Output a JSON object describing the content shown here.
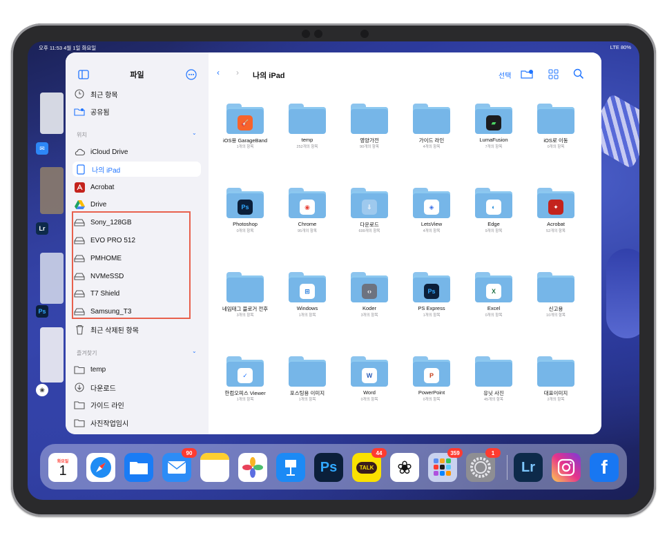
{
  "status": {
    "time_date": "오후 11:53  4월 1일 화요일",
    "right": "LTE  80%"
  },
  "sidebar": {
    "title": "파일",
    "items": [
      {
        "label": "최근 항목",
        "icon": "clock-icon"
      },
      {
        "label": "공유됨",
        "icon": "shared-folder-icon"
      }
    ],
    "locations_label": "위치",
    "locations": [
      {
        "label": "iCloud Drive",
        "icon": "cloud-icon"
      },
      {
        "label": "나의 iPad",
        "icon": "ipad-icon",
        "selected": true
      },
      {
        "label": "Acrobat",
        "icon": "acrobat-icon"
      },
      {
        "label": "Drive",
        "icon": "google-drive-icon"
      },
      {
        "label": "Sony_128GB",
        "icon": "drive-icon"
      },
      {
        "label": "EVO PRO 512",
        "icon": "drive-icon"
      },
      {
        "label": "PMHOME",
        "icon": "drive-icon"
      },
      {
        "label": "NVMeSSD",
        "icon": "drive-icon"
      },
      {
        "label": "T7 Shield",
        "icon": "drive-icon"
      },
      {
        "label": "Samsung_T3",
        "icon": "drive-icon"
      },
      {
        "label": "최근 삭제된 항목",
        "icon": "trash-icon"
      }
    ],
    "favorites_label": "즐겨찾기",
    "favorites": [
      {
        "label": "temp",
        "icon": "folder-icon"
      },
      {
        "label": "다운로드",
        "icon": "download-icon"
      },
      {
        "label": "가이드 라인",
        "icon": "folder-icon"
      },
      {
        "label": "사진작업임시",
        "icon": "folder-icon"
      }
    ]
  },
  "main": {
    "title": "나의 iPad",
    "select_label": "선택",
    "folders": [
      {
        "name": "iOS용 GarageBand",
        "count": "1개의 항목",
        "badge": "garageband",
        "color": "#f7632b"
      },
      {
        "name": "temp",
        "count": "252개의 항목"
      },
      {
        "name": "영양가전",
        "count": "90개의 항목"
      },
      {
        "name": "가이드 라인",
        "count": "4개의 항목"
      },
      {
        "name": "LumaFusion",
        "count": "7개의 항목",
        "badge": "lumafusion",
        "color": "#1c1c1e"
      },
      {
        "name": "iOS로 이동",
        "count": "0개의 항목"
      },
      {
        "name": "Photoshop",
        "count": "0개의 항목",
        "badge": "Ps",
        "color": "#0b1f3a"
      },
      {
        "name": "Chrome",
        "count": "95개의 항목",
        "badge": "chrome",
        "color": "#ffffff"
      },
      {
        "name": "다운로드",
        "count": "699개의 항목",
        "badge": "download",
        "color": "#9ec9ee"
      },
      {
        "name": "LetsView",
        "count": "4개의 항목",
        "badge": "letsview",
        "color": "#ffffff"
      },
      {
        "name": "Edge",
        "count": "9개의 항목",
        "badge": "edge",
        "color": "#ffffff"
      },
      {
        "name": "Acrobat",
        "count": "52개의 항목",
        "badge": "acrobat",
        "color": "#c4231d"
      },
      {
        "name": "네임태그 블로거 전후",
        "count": "3개의 항목"
      },
      {
        "name": "Windows",
        "count": "1개의 항목",
        "badge": "windows",
        "color": "#ffffff"
      },
      {
        "name": "Koder",
        "count": "3개의 항목",
        "badge": "koder",
        "color": "#6d7380"
      },
      {
        "name": "PS Express",
        "count": "1개의 항목",
        "badge": "Ps",
        "color": "#0b1f3a"
      },
      {
        "name": "Excel",
        "count": "0개의 항목",
        "badge": "excel",
        "color": "#ffffff"
      },
      {
        "name": "신고용",
        "count": "10개의 항목"
      },
      {
        "name": "한컴오피스 Viewer",
        "count": "1개의 항목",
        "badge": "hancom",
        "color": "#ffffff"
      },
      {
        "name": "포스팅용 이미지",
        "count": "1개의 항목"
      },
      {
        "name": "Word",
        "count": "0개의 항목",
        "badge": "word",
        "color": "#ffffff"
      },
      {
        "name": "PowerPoint",
        "count": "0개의 항목",
        "badge": "powerpoint",
        "color": "#ffffff"
      },
      {
        "name": "유닛 사진",
        "count": "45개의 항목"
      },
      {
        "name": "대표이미지",
        "count": "2개의 항목"
      }
    ]
  },
  "dock": {
    "calendar_day": "화요일",
    "calendar_date": "1",
    "apps": [
      {
        "name": "calendar",
        "badge": ""
      },
      {
        "name": "safari",
        "badge": ""
      },
      {
        "name": "files",
        "badge": ""
      },
      {
        "name": "mail",
        "badge": "90"
      },
      {
        "name": "notes",
        "badge": ""
      },
      {
        "name": "photos",
        "badge": ""
      },
      {
        "name": "keynote",
        "badge": ""
      },
      {
        "name": "photoshop",
        "label": "Ps",
        "badge": ""
      },
      {
        "name": "kakaotalk",
        "label": "TALK",
        "badge": "44"
      },
      {
        "name": "chatgpt",
        "badge": ""
      },
      {
        "name": "app-folder",
        "badge": "359"
      },
      {
        "name": "settings",
        "badge": "1"
      },
      {
        "name": "lightroom",
        "label": "Lr",
        "badge": ""
      },
      {
        "name": "instagram",
        "badge": ""
      },
      {
        "name": "facebook",
        "label": "f",
        "badge": ""
      }
    ]
  },
  "side_apps": {
    "lr": "Lr",
    "ps": "Ps"
  },
  "colors": {
    "accent": "#1f74ff",
    "highlight_box": "#e8604c"
  }
}
